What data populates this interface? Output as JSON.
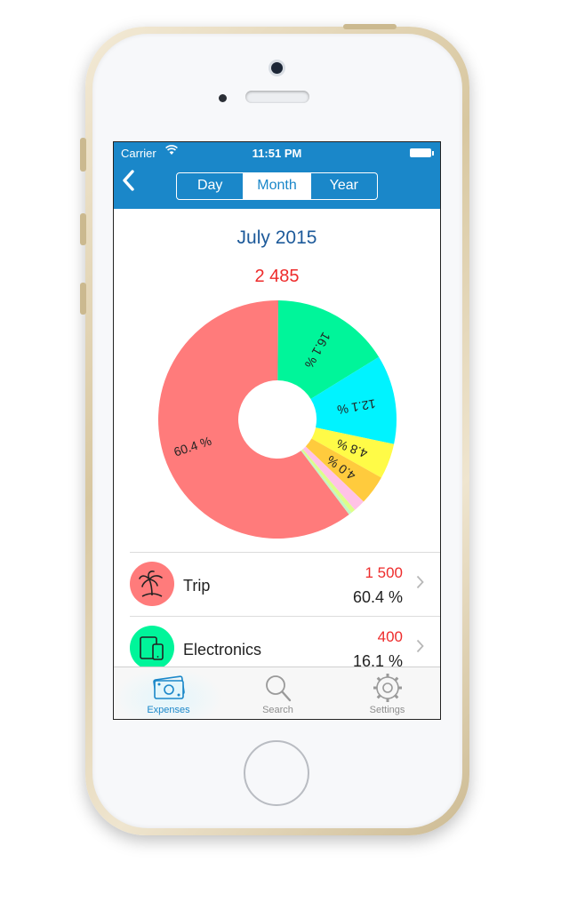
{
  "status_bar": {
    "carrier": "Carrier",
    "time": "11:51 PM"
  },
  "nav": {
    "back_icon": "chevron-left-icon",
    "segments": [
      "Day",
      "Month",
      "Year"
    ],
    "selected_segment": "Month"
  },
  "summary": {
    "period": "July 2015",
    "total": "2 485"
  },
  "chart_data": {
    "type": "pie",
    "title": "",
    "slices": [
      {
        "label": "60.4 %",
        "value": 60.4,
        "color": "#ff7b7b"
      },
      {
        "label": "16.1 %",
        "value": 16.1,
        "color": "#00f59a"
      },
      {
        "label": "12.1 %",
        "value": 12.1,
        "color": "#00f3ff"
      },
      {
        "label": "4.8 %",
        "value": 4.8,
        "color": "#fffb47"
      },
      {
        "label": "4.0 %",
        "value": 4.0,
        "color": "#ffcb3d"
      },
      {
        "label": "",
        "value": 1.6,
        "color": "#ffc3e6"
      },
      {
        "label": "",
        "value": 0.6,
        "color": "#dcff8a"
      },
      {
        "label": "",
        "value": 0.4,
        "color": "#c4f5c4"
      }
    ]
  },
  "categories": [
    {
      "name": "Trip",
      "amount": "1 500",
      "percent": "60.4 %",
      "icon": "palm-tree-icon",
      "color": "#ff7b7b"
    },
    {
      "name": "Electronics",
      "amount": "400",
      "percent": "16.1 %",
      "icon": "devices-icon",
      "color": "#00f59a"
    }
  ],
  "tabs": [
    {
      "label": "Expenses",
      "icon": "money-icon",
      "active": true
    },
    {
      "label": "Search",
      "icon": "search-icon",
      "active": false
    },
    {
      "label": "Settings",
      "icon": "gear-icon",
      "active": false
    }
  ]
}
